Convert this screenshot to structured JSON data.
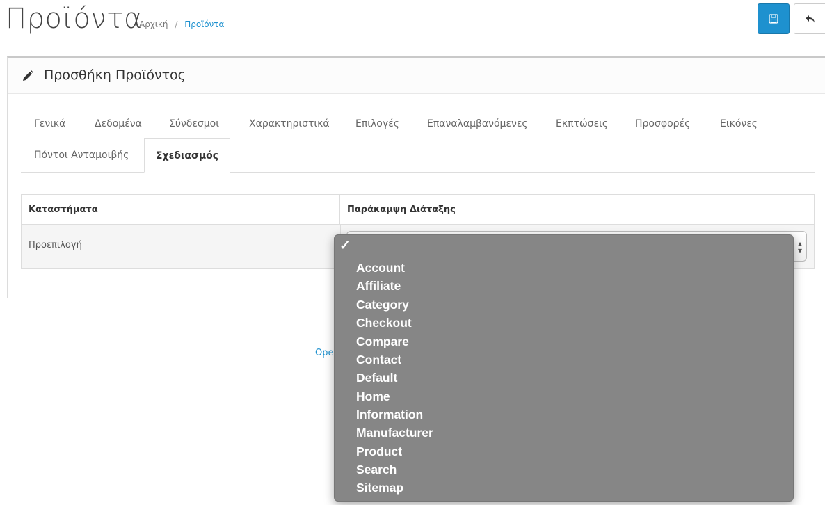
{
  "page": {
    "title": "Προϊόντα",
    "breadcrumb": {
      "home": "Αρχική",
      "separator": "/",
      "current": "Προϊόντα"
    }
  },
  "toolbar": {
    "save_icon": "floppy-disk-icon",
    "back_icon": "reply-arrow-icon"
  },
  "panel": {
    "heading": "Προσθήκη Προϊόντος",
    "heading_icon": "pencil-icon"
  },
  "tabs": {
    "row1": [
      "Γενικά",
      "Δεδομένα",
      "Σύνδεσμοι",
      "Χαρακτηριστικά",
      "Επιλογές",
      "Επαναλαμβανόμενες",
      "Εκπτώσεις",
      "Προσφορές",
      "Εικόνες"
    ],
    "row2": [
      "Πόντοι Ανταμοιβής"
    ],
    "active": "Σχεδιασμός"
  },
  "table": {
    "headers": [
      "Καταστήματα",
      "Παράκαμψη Διάταξης"
    ],
    "rows": [
      {
        "store": "Προεπιλογή",
        "layout": ""
      }
    ]
  },
  "footer": {
    "text_visible": "Ope"
  },
  "dropdown": {
    "selected_marker": "✓",
    "options": [
      "Account",
      "Affiliate",
      "Category",
      "Checkout",
      "Compare",
      "Contact",
      "Default",
      "Home",
      "Information",
      "Manufacturer",
      "Product",
      "Search",
      "Sitemap"
    ]
  },
  "colors": {
    "primary": "#1e91cf",
    "dropdown_bg": "#868686"
  }
}
